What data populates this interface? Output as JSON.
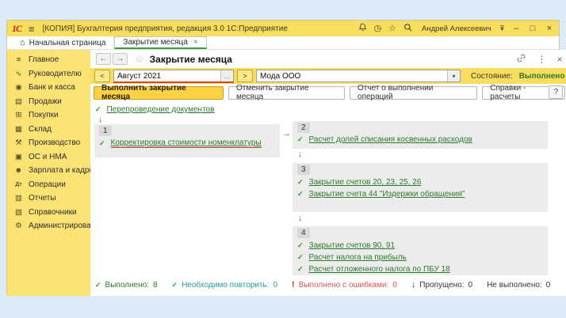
{
  "colors": {
    "titlebar_yellow": "#f8de5f",
    "sidebar_yellow": "#fbe373",
    "link_green": "#2c7a2c",
    "active_tab_green": "#3f9b3f",
    "primary_button_yellow": "#fcd244",
    "error_red": "#e05252",
    "repeat_teal": "#1f9e9e",
    "required_underline_orange": "#cf4a20"
  },
  "icons": {
    "menu": "≡",
    "history": "◷",
    "star": "☆",
    "home": "⌂",
    "back": "←",
    "forward": "→",
    "more": "⋮",
    "close": "×",
    "minimize": "–",
    "maximize": "□",
    "dots": "…",
    "dropdown": "▾",
    "step_back": "<",
    "step_forward": ">",
    "check": "✓",
    "arrow_down": "↓",
    "arrow_right": "→",
    "error": "!",
    "service_lines": "≡",
    "service_caret": "▾"
  },
  "titlebar": {
    "logo": "1С",
    "title": "[КОПИЯ] Бухгалтерия предприятия, редакция 3.0 1С:Предприятие",
    "user": "Андрей Алексеевич"
  },
  "tabs": [
    {
      "label": "Начальная страница"
    },
    {
      "label": "Закрытие месяца"
    }
  ],
  "sidebar": {
    "items": [
      {
        "label": "Главное",
        "icon": "≡"
      },
      {
        "label": "Руководителю",
        "icon": "∿"
      },
      {
        "label": "Банк и касса",
        "icon": "◉"
      },
      {
        "label": "Продажи",
        "icon": "▤"
      },
      {
        "label": "Покупки",
        "icon": "⊞"
      },
      {
        "label": "Склад",
        "icon": "▦"
      },
      {
        "label": "Производство",
        "icon": "⚒"
      },
      {
        "label": "ОС и НМА",
        "icon": "▣"
      },
      {
        "label": "Зарплата и кадры",
        "icon": "☻"
      },
      {
        "label": "Операции",
        "icon": "Дт"
      },
      {
        "label": "Отчеты",
        "icon": "▥"
      },
      {
        "label": "Справочники",
        "icon": "▧"
      },
      {
        "label": "Администрирование",
        "icon": "⚙"
      }
    ]
  },
  "form": {
    "title": "Закрытие месяца",
    "period_value": "Август 2021",
    "org_value": "Мода ООО",
    "status_label": "Состояние:",
    "status_value": "Выполнено",
    "buttons": [
      "Выполнить закрытие месяца",
      "Отменить закрытие месяца",
      "Отчет о выполнении операций",
      "Справки - расчеты"
    ],
    "help": "?"
  },
  "scheme": {
    "pre_step": {
      "label": "Перепроведение документов"
    },
    "blocks": [
      {
        "num": "1",
        "items": [
          {
            "label": "Корректировка стоимости номенклатуры"
          }
        ]
      },
      {
        "num": "2",
        "items": [
          {
            "label": "Расчет долей списания косвенных расходов"
          }
        ]
      },
      {
        "num": "3",
        "items": [
          {
            "label": "Закрытие счетов 20, 23, 25, 26"
          },
          {
            "label": "Закрытие счета 44 \"Издержки обращения\""
          }
        ]
      },
      {
        "num": "4",
        "items": [
          {
            "label": "Закрытие счетов 90, 91"
          },
          {
            "label": "Расчет налога на прибыль"
          },
          {
            "label": "Расчет отложенного налога по ПБУ 18"
          }
        ]
      }
    ]
  },
  "legend": {
    "items": [
      {
        "label": "Выполнено:",
        "value": "8"
      },
      {
        "label": "Необходимо повторить:",
        "value": "0"
      },
      {
        "label": "Выполнено с ошибками:",
        "value": "0"
      },
      {
        "label": "Пропущено:",
        "value": "0"
      },
      {
        "label": "Не выполнено:",
        "value": "0"
      }
    ]
  }
}
